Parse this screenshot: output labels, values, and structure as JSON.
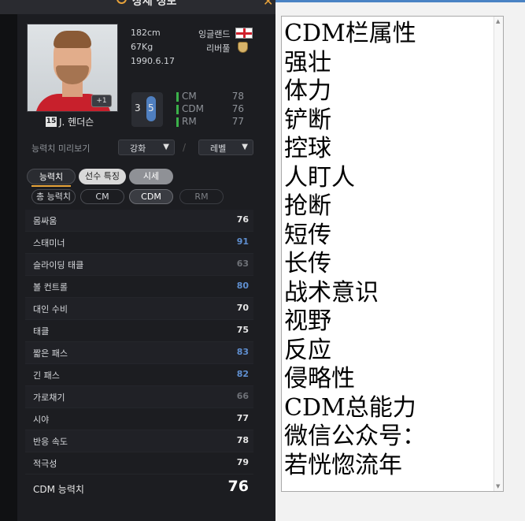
{
  "game_panel": {
    "title": "상세 정보",
    "player": {
      "number": "15",
      "name": "J. 헨더슨",
      "height": "182cm",
      "weight": "67Kg",
      "birthdate": "1990.6.17",
      "nationality": "잉글랜드",
      "club": "리버풀",
      "enhance_badge": "+1",
      "left_foot": "3",
      "right_foot": "5"
    },
    "positions": [
      {
        "pos": "CM",
        "value": "78"
      },
      {
        "pos": "CDM",
        "value": "76"
      },
      {
        "pos": "RM",
        "value": "77"
      }
    ],
    "preview": {
      "label": "능력치 미리보기",
      "enhance_dropdown": "강화",
      "separator": "/",
      "level_dropdown": "레벨"
    },
    "tabs": [
      "능력치",
      "선수 특징",
      "시세"
    ],
    "chips": [
      "총 능력치",
      "CM",
      "CDM",
      "RM"
    ],
    "stats": [
      {
        "name": "몸싸움",
        "value": "76"
      },
      {
        "name": "스태미너",
        "value": "91"
      },
      {
        "name": "슬라이딩 태클",
        "value": "63"
      },
      {
        "name": "볼 컨트롤",
        "value": "80"
      },
      {
        "name": "대인 수비",
        "value": "70"
      },
      {
        "name": "태클",
        "value": "75"
      },
      {
        "name": "짧은 패스",
        "value": "83"
      },
      {
        "name": "긴 패스",
        "value": "82"
      },
      {
        "name": "가로채기",
        "value": "66"
      },
      {
        "name": "시야",
        "value": "77"
      },
      {
        "name": "반응 속도",
        "value": "78"
      },
      {
        "name": "적극성",
        "value": "79"
      }
    ],
    "total": {
      "label": "CDM 능력치",
      "value": "76"
    }
  },
  "editor": {
    "lines": [
      "CDM栏属性",
      "强壮",
      "体力",
      "铲断",
      "控球",
      "人盯人",
      "抢断",
      "短传",
      "长传",
      "战术意识",
      "视野",
      "反应",
      "侵略性",
      "CDM总能力",
      "微信公众号：",
      "若恍惚流年"
    ]
  },
  "colors": {
    "accent_orange": "#e8a53a",
    "position_green": "#3bb14a",
    "high_stat_blue": "#5f8fd0",
    "editor_border_blue": "#4a83c4"
  }
}
